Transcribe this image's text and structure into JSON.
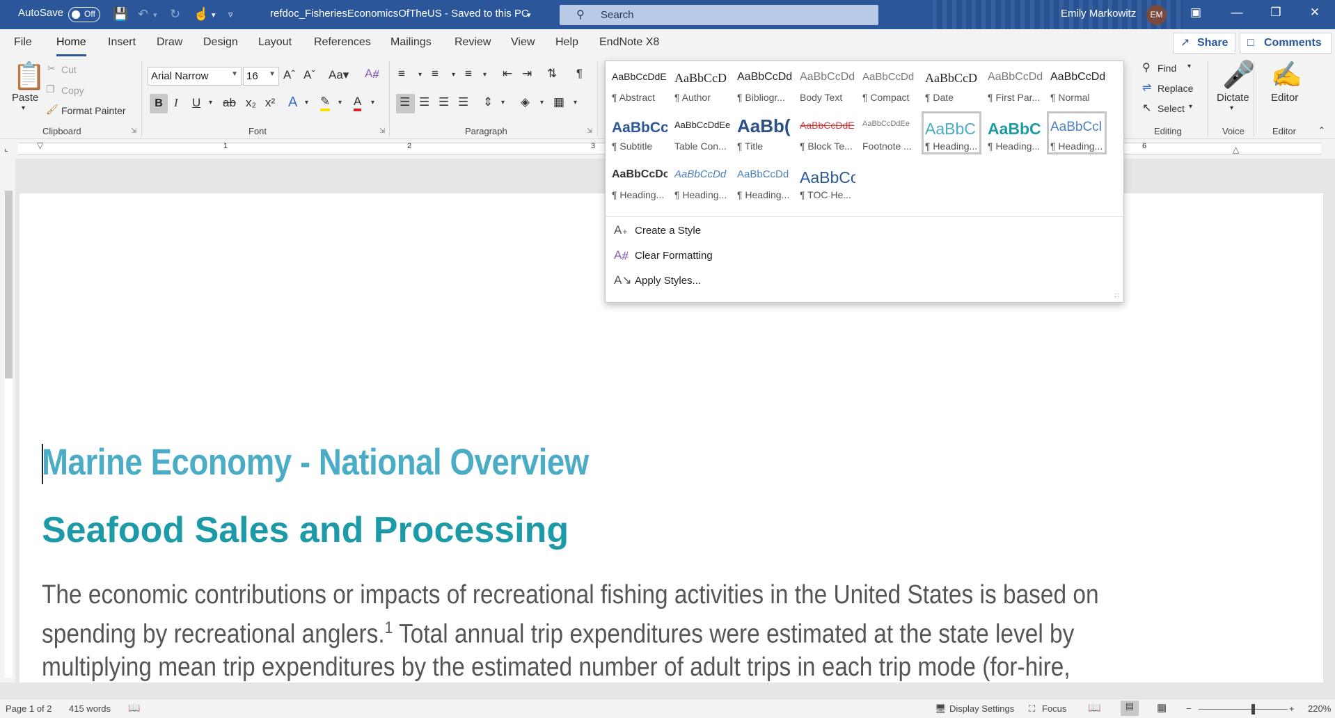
{
  "titlebar": {
    "autosave_label": "AutoSave",
    "autosave_state": "Off",
    "document_title": "refdoc_FisheriesEconomicsOfTheUS  -  Saved to this PC",
    "search_placeholder": "Search",
    "user_name": "Emily Markowitz",
    "user_initials": "EM"
  },
  "menu": {
    "tabs": [
      "File",
      "Home",
      "Insert",
      "Draw",
      "Design",
      "Layout",
      "References",
      "Mailings",
      "Review",
      "View",
      "Help",
      "EndNote X8"
    ],
    "active_tab": "Home",
    "share_label": "Share",
    "comments_label": "Comments"
  },
  "ribbon": {
    "clipboard": {
      "paste": "Paste",
      "cut": "Cut",
      "copy": "Copy",
      "format_painter": "Format Painter",
      "group_label": "Clipboard"
    },
    "font": {
      "family": "Arial Narrow",
      "size": "16",
      "group_label": "Font"
    },
    "paragraph": {
      "group_label": "Paragraph"
    },
    "editing": {
      "find": "Find",
      "replace": "Replace",
      "select": "Select",
      "group_label": "Editing"
    },
    "voice": {
      "dictate": "Dictate",
      "group_label": "Voice"
    },
    "editor": {
      "editor": "Editor",
      "group_label": "Editor"
    }
  },
  "ruler": {
    "numbers": [
      "1",
      "2",
      "3",
      "6"
    ]
  },
  "styles_gallery": {
    "rows": [
      [
        {
          "preview": "AaBbCcDdE",
          "name": "¶ Abstract"
        },
        {
          "preview": "AaBbCcD",
          "name": "¶ Author"
        },
        {
          "preview": "AaBbCcDdl",
          "name": "¶ Bibliogr..."
        },
        {
          "preview": "AaBbCcDdl",
          "name": "Body Text"
        },
        {
          "preview": "AaBbCcDd",
          "name": "¶ Compact"
        },
        {
          "preview": "AaBbCcD",
          "name": "¶ Date"
        },
        {
          "preview": "AaBbCcDdl",
          "name": "¶ First Par..."
        },
        {
          "preview": "AaBbCcDdl",
          "name": "¶ Normal"
        }
      ],
      [
        {
          "preview": "AaBbCc",
          "name": "¶ Subtitle"
        },
        {
          "preview": "AaBbCcDdEe",
          "name": "Table Con..."
        },
        {
          "preview": "AaBb(",
          "name": "¶ Title"
        },
        {
          "preview": "AaBbCcDdE",
          "name": "¶ Block Te..."
        },
        {
          "preview": "AaBbCcDdEe",
          "name": "Footnote ..."
        },
        {
          "preview": "AaBbC",
          "name": "¶ Heading..."
        },
        {
          "preview": "AaBbC",
          "name": "¶ Heading..."
        },
        {
          "preview": "AaBbCcl",
          "name": "¶ Heading..."
        }
      ],
      [
        {
          "preview": "AaBbCcDc",
          "name": "¶ Heading..."
        },
        {
          "preview": "AaBbCcDd",
          "name": "¶ Heading..."
        },
        {
          "preview": "AaBbCcDd",
          "name": "¶ Heading..."
        },
        {
          "preview": "AaBbCc",
          "name": "¶ TOC He..."
        }
      ]
    ],
    "actions": [
      "Create a Style",
      "Clear Formatting",
      "Apply Styles..."
    ]
  },
  "document": {
    "heading1": "Marine Economy - National Overview",
    "heading2": "Seafood Sales and Processing",
    "paragraph_part1": "The economic contributions or impacts of recreational fishing activities in the United States is based on spending by recreational anglers.",
    "footnote_ref": "1",
    "paragraph_part2": " Total annual trip expenditures were estimated at the state level by multiplying mean trip expenditures by the estimated number of adult trips in each trip mode (for-hire, private boat, and shore) and adjusting by the CPI (consumer price index) to the current year. Total annual durable expenditures were estimated by"
  },
  "statusbar": {
    "page": "Page 1 of 2",
    "words": "415 words",
    "display_settings": "Display Settings",
    "focus": "Focus",
    "zoom": "220%"
  },
  "colors": {
    "title_bar": "#2b579a",
    "heading1": "#4bacc6",
    "heading2": "#1d9aa7"
  }
}
